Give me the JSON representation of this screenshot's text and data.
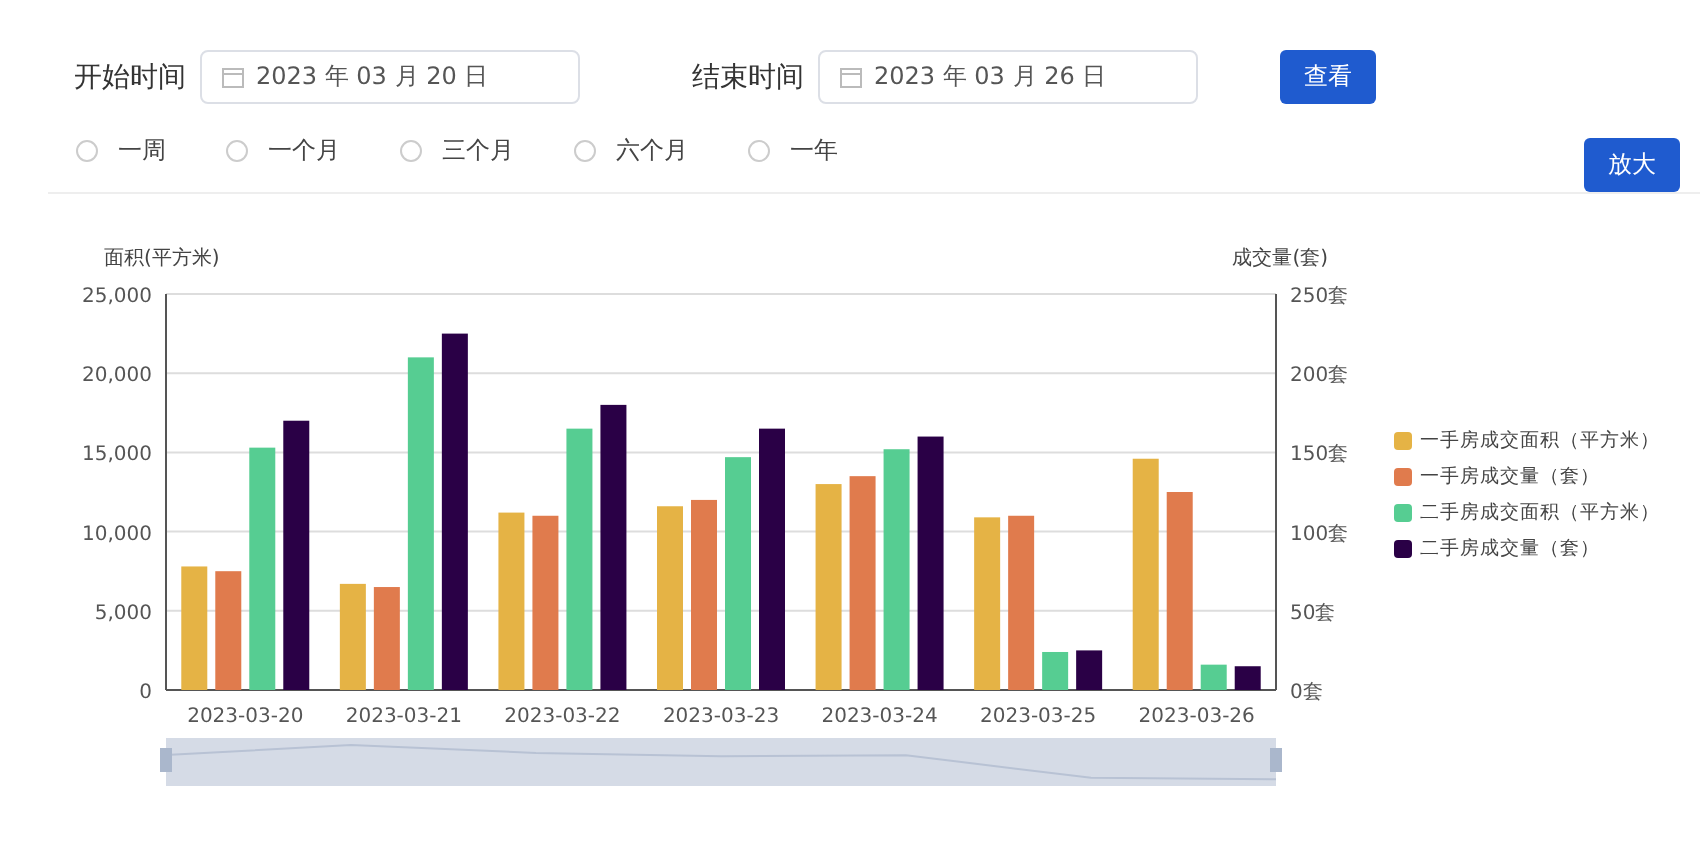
{
  "filters": {
    "start": {
      "label": "开始时间",
      "value": "2023 年 03 月 20 日"
    },
    "end": {
      "label": "结束时间",
      "value": "2023 年 03 月 26 日"
    },
    "query_button": "查看"
  },
  "ranges": [
    {
      "label": "一周",
      "selected": false
    },
    {
      "label": "一个月",
      "selected": false
    },
    {
      "label": "三个月",
      "selected": false
    },
    {
      "label": "六个月",
      "selected": false
    },
    {
      "label": "一年",
      "selected": false
    }
  ],
  "zoom_button": "放大",
  "chart": {
    "chart_data": {
      "type": "bar",
      "ylabel": "面积(平方米)",
      "y2label": "成交量(套)",
      "categories": [
        "2023-03-20",
        "2023-03-21",
        "2023-03-22",
        "2023-03-23",
        "2023-03-24",
        "2023-03-25",
        "2023-03-26"
      ],
      "ylim": [
        0,
        25000
      ],
      "yticks": [
        {
          "value": 0,
          "label": "0"
        },
        {
          "value": 5000,
          "label": "5,000"
        },
        {
          "value": 10000,
          "label": "10,000"
        },
        {
          "value": 15000,
          "label": "15,000"
        },
        {
          "value": 20000,
          "label": "20,000"
        },
        {
          "value": 25000,
          "label": "25,000"
        }
      ],
      "y2lim": [
        0,
        250
      ],
      "y2ticks": [
        {
          "value": 0,
          "label": "0套"
        },
        {
          "value": 50,
          "label": "50套"
        },
        {
          "value": 100,
          "label": "100套"
        },
        {
          "value": 150,
          "label": "150套"
        },
        {
          "value": 200,
          "label": "200套"
        },
        {
          "value": 250,
          "label": "250套"
        }
      ],
      "series": [
        {
          "name": "一手房成交面积（平方米）",
          "color": "#e5b345",
          "values": [
            7800,
            6700,
            11200,
            11600,
            13000,
            10900,
            14600
          ]
        },
        {
          "name": "一手房成交量（套）",
          "color": "#e07b4d",
          "axis": "y2",
          "values": [
            75,
            65,
            110,
            120,
            135,
            110,
            125
          ]
        },
        {
          "name": "二手房成交面积（平方米）",
          "color": "#56cd92",
          "values": [
            15300,
            21000,
            16500,
            14700,
            15200,
            2400,
            1600
          ]
        },
        {
          "name": "二手房成交量（套）",
          "color": "#2a0046",
          "axis": "y2",
          "values": [
            170,
            225,
            180,
            165,
            160,
            25,
            15
          ]
        }
      ],
      "stacked": false,
      "grid": true
    }
  }
}
